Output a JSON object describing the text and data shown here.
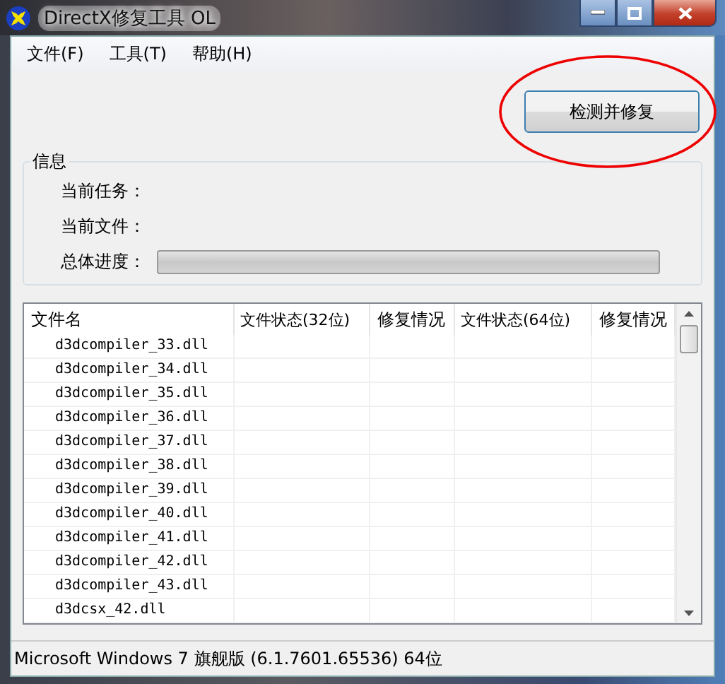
{
  "window": {
    "title": "DirectX修复工具 OL"
  },
  "menu": [
    {
      "label": "文件(F)"
    },
    {
      "label": "工具(T)"
    },
    {
      "label": "帮助(H)"
    }
  ],
  "repair_button": {
    "label": "检测并修复"
  },
  "info": {
    "title": "信息",
    "task_label": "当前任务：",
    "file_label": "当前文件：",
    "progress_label": "总体进度：",
    "progress": {
      "level": 0
    }
  },
  "table": {
    "columns": [
      "文件名",
      "文件状态(32位)",
      "修复情况",
      "文件状态(64位)",
      "修复情况"
    ],
    "rows": [
      {
        "name": "d3dcompiler_33.dll"
      },
      {
        "name": "d3dcompiler_34.dll"
      },
      {
        "name": "d3dcompiler_35.dll"
      },
      {
        "name": "d3dcompiler_36.dll"
      },
      {
        "name": "d3dcompiler_37.dll"
      },
      {
        "name": "d3dcompiler_38.dll"
      },
      {
        "name": "d3dcompiler_39.dll"
      },
      {
        "name": "d3dcompiler_40.dll"
      },
      {
        "name": "d3dcompiler_41.dll"
      },
      {
        "name": "d3dcompiler_42.dll"
      },
      {
        "name": "d3dcompiler_43.dll"
      },
      {
        "name": "d3dcsx_42.dll"
      }
    ]
  },
  "status_bar": "Microsoft Windows 7 旗舰版 (6.1.7601.65536) 64位"
}
